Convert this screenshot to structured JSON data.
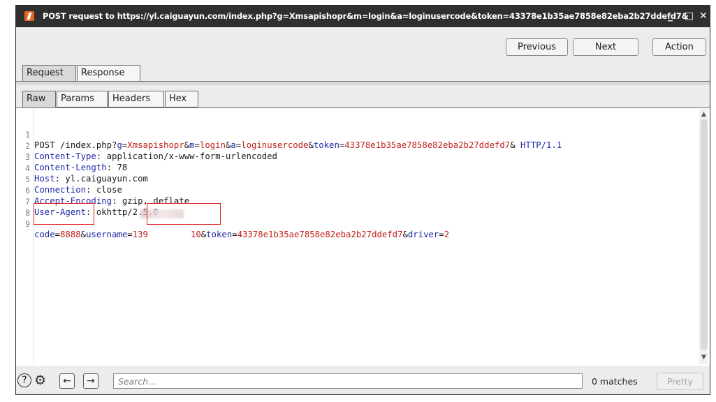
{
  "window": {
    "title": "POST request to https://yl.caiguayun.com/index.php?g=Xmsapishopr&m=login&a=loginusercode&token=43378e1b35ae7858e82eba2b27ddefd7&",
    "min_icon": "_",
    "max_icon": "□",
    "close_icon": "✕"
  },
  "toolbar": {
    "previous_label": "Previous",
    "next_label": "Next",
    "action_label": "Action"
  },
  "tabs": {
    "request": "Request",
    "response": "Response"
  },
  "subtabs": {
    "raw": "Raw",
    "params": "Params",
    "headers": "Headers",
    "hex": "Hex"
  },
  "editor": {
    "line_numbers": [
      "1",
      "2",
      "3",
      "4",
      "5",
      "6",
      "7",
      "8",
      "9"
    ],
    "line1": {
      "prefix": "POST /index.php?",
      "g_key": "g",
      "eq": "=",
      "g_val": "Xmsapishopr",
      "amp": "&",
      "m_key": "m",
      "m_val": "login",
      "a_key": "a",
      "a_val": "loginusercode",
      "token_key": "token",
      "token_val": "43378e1b35ae7858e82eba2b27ddefd7",
      "trail": "& ",
      "proto": "HTTP/1.1"
    },
    "headers": [
      {
        "name": "Content-Type",
        "value": " application/x-www-form-urlencoded"
      },
      {
        "name": "Content-Length",
        "value": " 78"
      },
      {
        "name": "Host",
        "value": " yl.caiguayun.com"
      },
      {
        "name": "Connection",
        "value": " close"
      },
      {
        "name": "Accept-Encoding",
        "value": " gzip, deflate"
      },
      {
        "name": "User-Agent",
        "value": " okhttp/2.5.0"
      }
    ],
    "body": {
      "code_key": "code",
      "code_val": "8888",
      "username_key": "username",
      "username_val_start": "139",
      "username_val_end": "10",
      "token_key": "token",
      "token_val": "43378e1b35ae7858e82eba2b27ddefd7",
      "driver_key": "driver",
      "driver_val": "2"
    },
    "colors": {
      "key": "#1f28a8",
      "value": "#c2211b",
      "highlight": "#e02020"
    }
  },
  "footer": {
    "help_icon": "?",
    "gear_icon": "⚙",
    "back_icon": "←",
    "forward_icon": "→",
    "search_placeholder": "Search...",
    "matches_text": "0 matches",
    "pretty_label": "Pretty"
  }
}
